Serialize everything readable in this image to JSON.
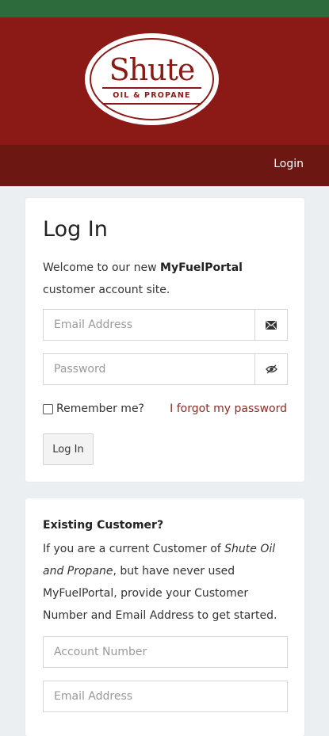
{
  "brand": {
    "name": "Shute",
    "subtitle": "OIL & PROPANE",
    "colors": {
      "maroon": "#8b1a17",
      "nav": "#6d1713",
      "green": "#2e6b3c"
    }
  },
  "nav": {
    "login_link": "Login"
  },
  "login": {
    "title": "Log In",
    "welcome_prefix": "Welcome to our new ",
    "welcome_brand": "MyFuelPortal",
    "welcome_suffix": " customer account site.",
    "email_placeholder": "Email Address",
    "password_placeholder": "Password",
    "remember_label": "Remember me?",
    "forgot_link": "I forgot my password",
    "submit_label": "Log In",
    "email_icon": "envelope-icon",
    "password_icon": "eye-slash-icon"
  },
  "existing": {
    "title": "Existing Customer?",
    "text_1": "If you are a current Customer of ",
    "text_company": "Shute Oil and Propane",
    "text_2": ", but have never used MyFuelPortal, provide your Customer Number and Email Address to get started.",
    "account_placeholder": "Account Number",
    "email_placeholder": "Email Address"
  }
}
